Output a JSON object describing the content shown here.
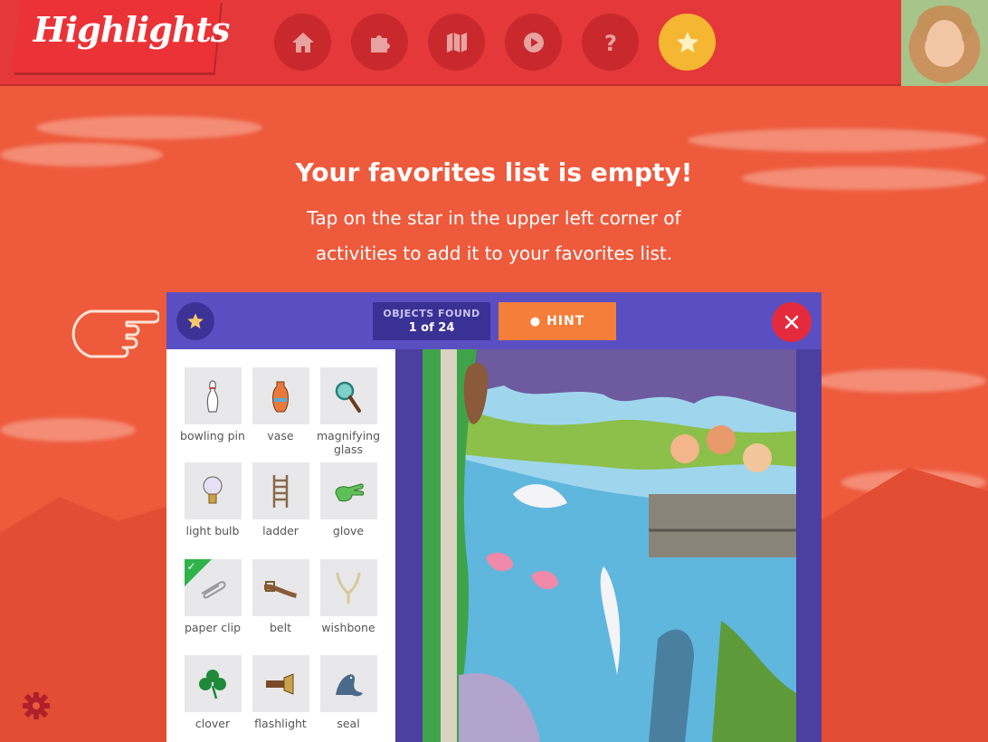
{
  "header": {
    "logo_text": "Highlights",
    "nav": [
      {
        "icon": "home-icon"
      },
      {
        "icon": "puzzle-icon"
      },
      {
        "icon": "map-icon"
      },
      {
        "icon": "play-icon"
      },
      {
        "icon": "question-icon"
      },
      {
        "icon": "star-icon",
        "active": true
      }
    ]
  },
  "message": {
    "title": "Your favorites list is empty!",
    "body": "Tap on the star in the upper left corner of activities to add it to your favorites list."
  },
  "game": {
    "objects_found_label": "OBJECTS FOUND",
    "objects_found_value": "1 of 24",
    "hint_label": "HINT",
    "items": [
      {
        "label": "bowling pin",
        "found": false
      },
      {
        "label": "vase",
        "found": false
      },
      {
        "label": "magnifying glass",
        "found": false
      },
      {
        "label": "light bulb",
        "found": false
      },
      {
        "label": "ladder",
        "found": false
      },
      {
        "label": "glove",
        "found": false
      },
      {
        "label": "paper clip",
        "found": true
      },
      {
        "label": "belt",
        "found": false
      },
      {
        "label": "wishbone",
        "found": false
      },
      {
        "label": "clover",
        "found": false
      },
      {
        "label": "flashlight",
        "found": false
      },
      {
        "label": "seal",
        "found": false
      }
    ]
  },
  "colors": {
    "background": "#ee5a3c",
    "header": "#e4383a",
    "nav_button": "#c9292d",
    "active_nav": "#f5b731",
    "panel": "#5a4fc2",
    "hint": "#f47e3a",
    "close": "#e32b3d",
    "found_check": "#2fb34a"
  }
}
